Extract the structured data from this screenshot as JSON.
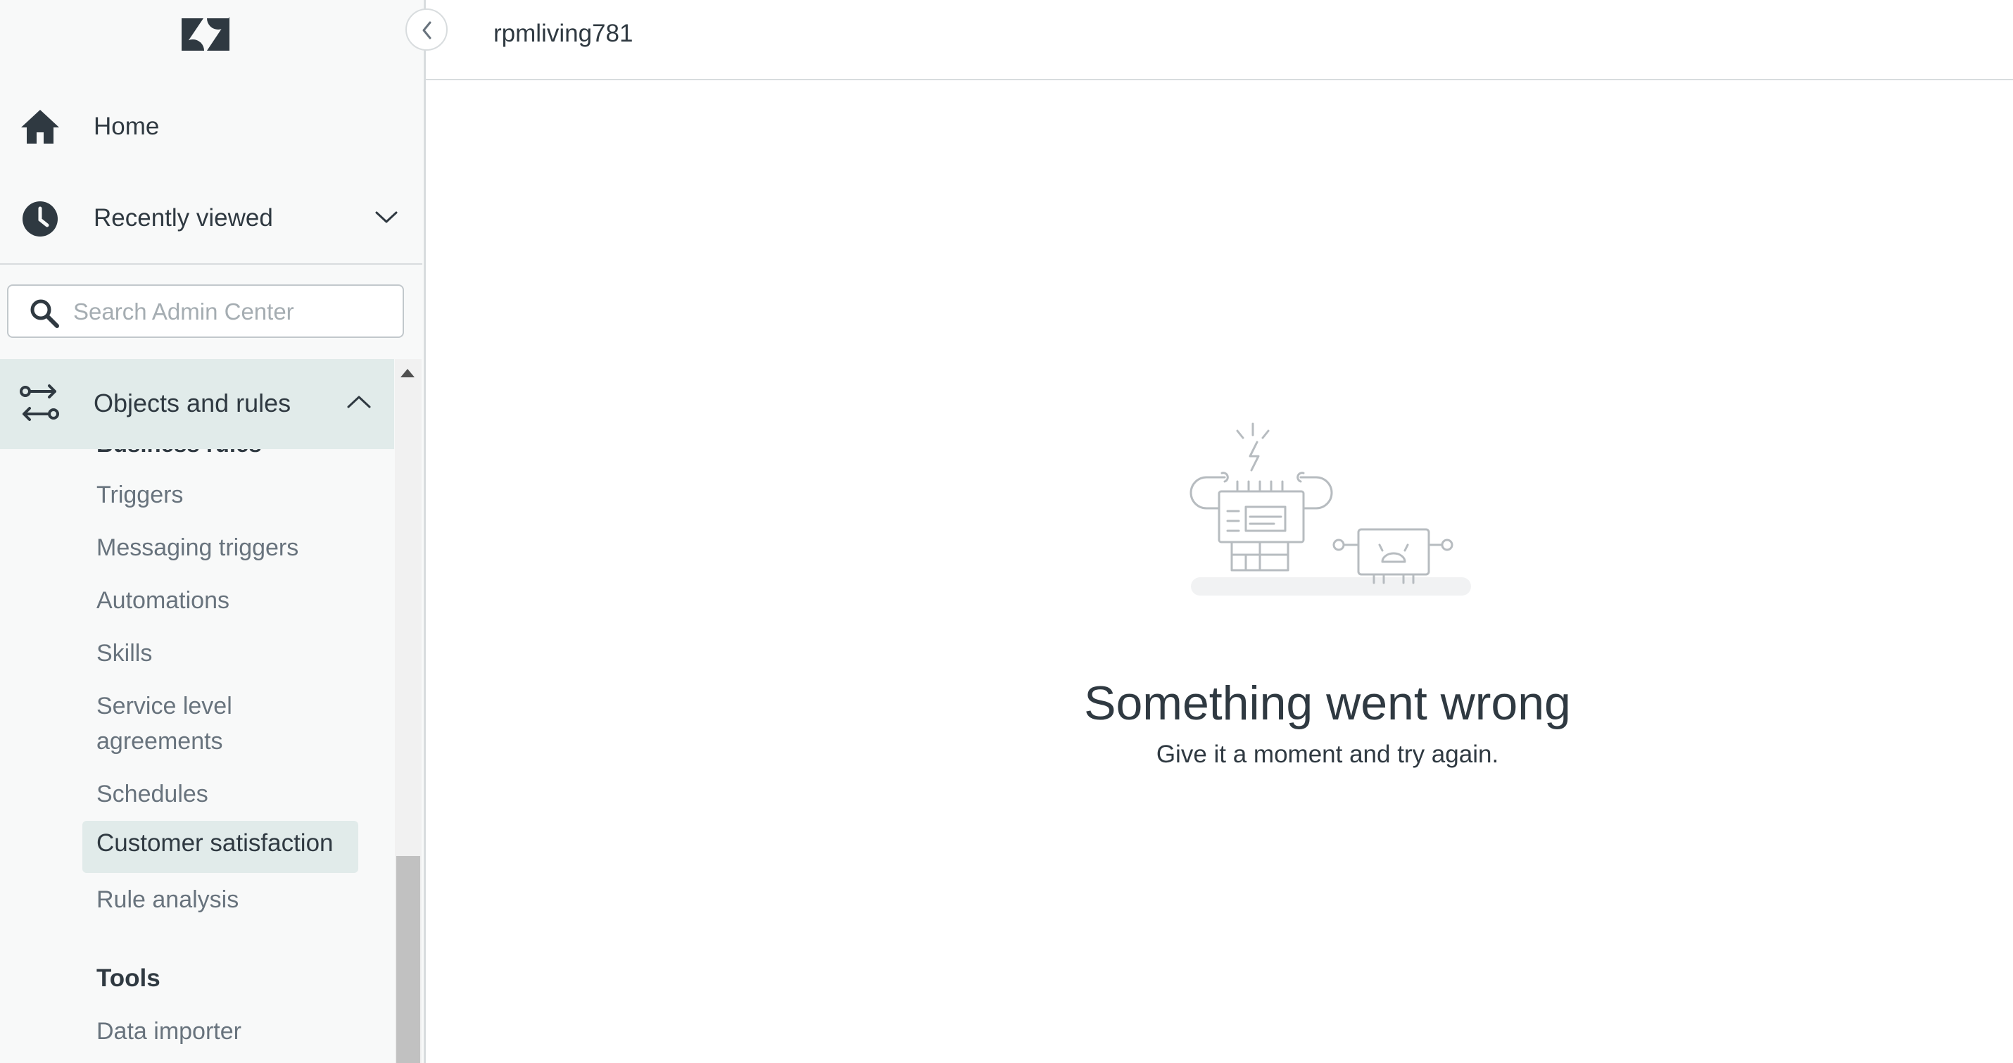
{
  "app": {
    "brand": "Zendesk",
    "account": "rpmliving781"
  },
  "sidebar": {
    "collapse_icon": "chevron-left-icon",
    "home": {
      "label": "Home",
      "icon": "house-icon"
    },
    "recently_viewed": {
      "label": "Recently viewed",
      "icon": "clock-icon",
      "expanded": false
    },
    "search": {
      "placeholder": "Search Admin Center",
      "value": ""
    },
    "section": {
      "label": "Objects and rules",
      "icon": "arrows-swap-icon",
      "expanded": true,
      "clipped_group": "Business rules",
      "items": [
        "Triggers",
        "Messaging triggers",
        "Automations",
        "Skills",
        "Service level agreements",
        "Schedules",
        "Customer satisfaction",
        "Rule analysis"
      ],
      "selected_item": "Customer satisfaction",
      "tools_heading": "Tools",
      "tools_items": [
        "Data importer"
      ]
    }
  },
  "main": {
    "error_title": "Something went wrong",
    "error_subtitle": "Give it a moment and try again.",
    "illustration": "broken-robots-illustration"
  },
  "colors": {
    "sidebar_bg": "#f8f9f9",
    "selected_bg": "#e1ebea",
    "text_primary": "#2f3941",
    "text_secondary": "#68737d",
    "border": "#d8dcde"
  }
}
